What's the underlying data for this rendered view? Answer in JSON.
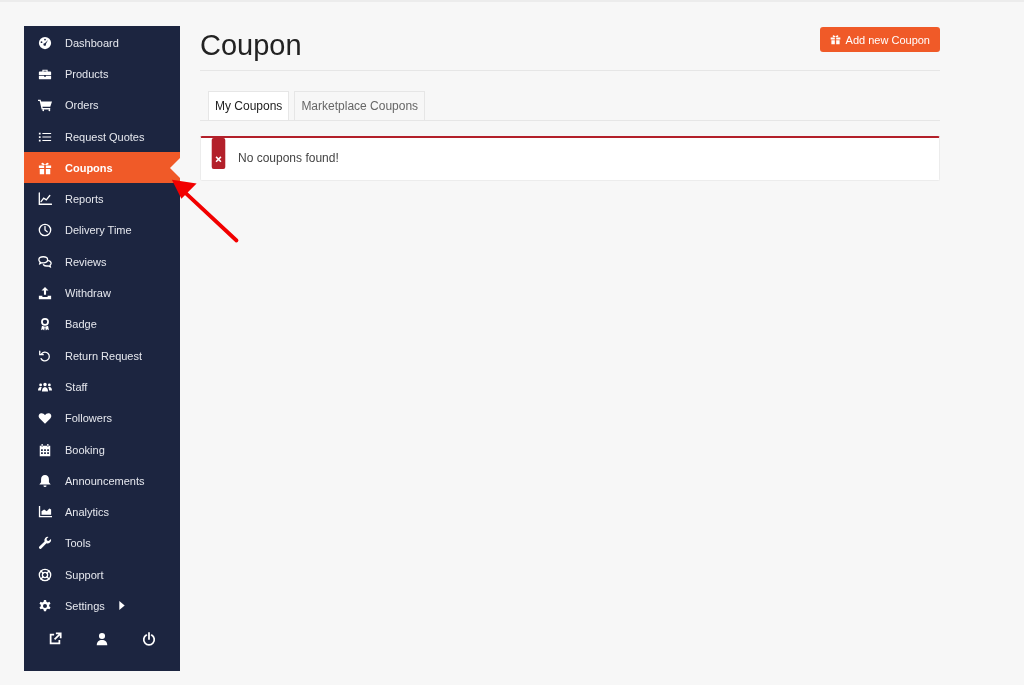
{
  "sidebar": {
    "items": [
      {
        "label": "Dashboard",
        "selected": false
      },
      {
        "label": "Products",
        "selected": false
      },
      {
        "label": "Orders",
        "selected": false
      },
      {
        "label": "Request Quotes",
        "selected": false
      },
      {
        "label": "Coupons",
        "selected": true
      },
      {
        "label": "Reports",
        "selected": false
      },
      {
        "label": "Delivery Time",
        "selected": false
      },
      {
        "label": "Reviews",
        "selected": false
      },
      {
        "label": "Withdraw",
        "selected": false
      },
      {
        "label": "Badge",
        "selected": false
      },
      {
        "label": "Return Request",
        "selected": false
      },
      {
        "label": "Staff",
        "selected": false
      },
      {
        "label": "Followers",
        "selected": false
      },
      {
        "label": "Booking",
        "selected": false
      },
      {
        "label": "Announcements",
        "selected": false
      },
      {
        "label": "Analytics",
        "selected": false
      },
      {
        "label": "Tools",
        "selected": false
      },
      {
        "label": "Support",
        "selected": false
      },
      {
        "label": "Settings",
        "selected": false,
        "expandable": true
      }
    ]
  },
  "page": {
    "title": "Coupon",
    "add_button": "Add new Coupon",
    "tabs": [
      {
        "label": "My Coupons",
        "selected": true
      },
      {
        "label": "Marketplace Coupons",
        "selected": false
      }
    ],
    "notice": {
      "kind": "error",
      "text": "No coupons found!"
    }
  }
}
